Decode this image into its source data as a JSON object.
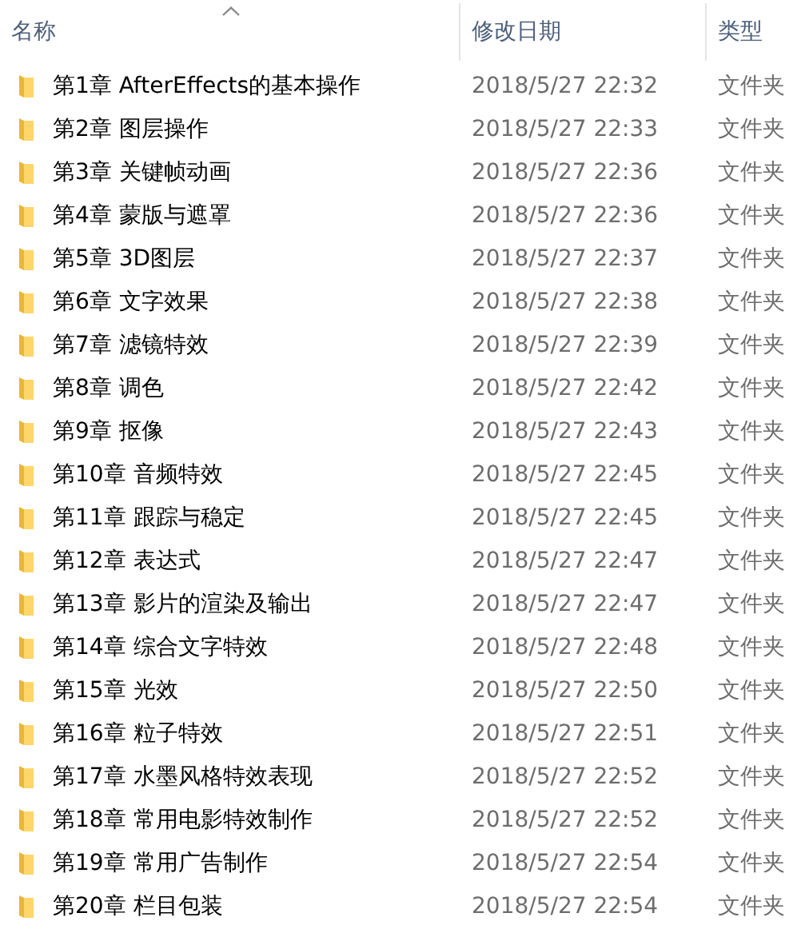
{
  "columns": [
    {
      "label": "名称",
      "sorted": true
    },
    {
      "label": "修改日期",
      "sorted": false
    },
    {
      "label": "类型",
      "sorted": false
    }
  ],
  "rows": [
    {
      "name": "第1章 AfterEffects的基本操作",
      "date": "2018/5/27 22:32",
      "type": "文件夹"
    },
    {
      "name": "第2章 图层操作",
      "date": "2018/5/27 22:33",
      "type": "文件夹"
    },
    {
      "name": "第3章 关键帧动画",
      "date": "2018/5/27 22:36",
      "type": "文件夹"
    },
    {
      "name": "第4章 蒙版与遮罩",
      "date": "2018/5/27 22:36",
      "type": "文件夹"
    },
    {
      "name": "第5章 3D图层",
      "date": "2018/5/27 22:37",
      "type": "文件夹"
    },
    {
      "name": "第6章 文字效果",
      "date": "2018/5/27 22:38",
      "type": "文件夹"
    },
    {
      "name": "第7章 滤镜特效",
      "date": "2018/5/27 22:39",
      "type": "文件夹"
    },
    {
      "name": "第8章 调色",
      "date": "2018/5/27 22:42",
      "type": "文件夹"
    },
    {
      "name": "第9章 抠像",
      "date": "2018/5/27 22:43",
      "type": "文件夹"
    },
    {
      "name": "第10章 音频特效",
      "date": "2018/5/27 22:45",
      "type": "文件夹"
    },
    {
      "name": "第11章 跟踪与稳定",
      "date": "2018/5/27 22:45",
      "type": "文件夹"
    },
    {
      "name": "第12章 表达式",
      "date": "2018/5/27 22:47",
      "type": "文件夹"
    },
    {
      "name": "第13章 影片的渲染及输出",
      "date": "2018/5/27 22:47",
      "type": "文件夹"
    },
    {
      "name": "第14章 综合文字特效",
      "date": "2018/5/27 22:48",
      "type": "文件夹"
    },
    {
      "name": "第15章 光效",
      "date": "2018/5/27 22:50",
      "type": "文件夹"
    },
    {
      "name": "第16章 粒子特效",
      "date": "2018/5/27 22:51",
      "type": "文件夹"
    },
    {
      "name": "第17章 水墨风格特效表现",
      "date": "2018/5/27 22:52",
      "type": "文件夹"
    },
    {
      "name": "第18章 常用电影特效制作",
      "date": "2018/5/27 22:52",
      "type": "文件夹"
    },
    {
      "name": "第19章 常用广告制作",
      "date": "2018/5/27 22:54",
      "type": "文件夹"
    },
    {
      "name": "第20章 栏目包装",
      "date": "2018/5/27 22:54",
      "type": "文件夹"
    }
  ]
}
